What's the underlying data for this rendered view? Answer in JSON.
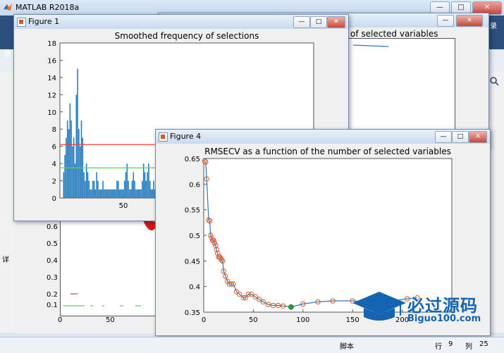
{
  "matlab": {
    "title": "MATLAB R2018a",
    "controls": {
      "minimize": "—",
      "maximize": "□",
      "close": "✕"
    },
    "toolstrip_fragments": {
      "left_char": "数",
      "left_char2": "当",
      "right_char": "录",
      "side_char": "详"
    },
    "status": {
      "script": "脚本",
      "row_label": "行",
      "row_value": "9",
      "col_label": "列",
      "col_value": "25"
    }
  },
  "figure1": {
    "title": "Figure 1",
    "controls": {
      "minimize": "—",
      "maximize": "□",
      "close": "✕"
    },
    "chart_data": {
      "type": "bar",
      "title": "Smoothed frequency of selections",
      "xlim": [
        0,
        200
      ],
      "ylim": [
        0,
        18
      ],
      "x_ticks": [
        "50"
      ],
      "y_ticks": [
        "0",
        "2",
        "4",
        "6",
        "8",
        "10",
        "12",
        "14",
        "16",
        "18"
      ],
      "threshold_red": 6.2,
      "threshold_green": 3.5,
      "bar_color": "#2c7fc1",
      "red_line_color": "#ff3b3b",
      "green_line_color": "#45e045",
      "values": [
        0,
        0,
        3,
        5,
        7,
        9,
        8,
        11,
        9,
        6,
        7,
        4,
        12,
        15,
        8,
        6,
        9,
        7,
        3,
        2,
        4,
        3,
        2,
        1,
        1,
        2,
        2,
        1,
        3,
        2,
        1,
        1,
        1,
        2,
        1,
        1,
        1,
        1,
        1,
        1,
        1,
        1,
        1,
        1,
        2,
        2,
        1,
        1,
        1,
        1,
        2,
        3,
        4,
        2,
        1,
        1,
        2,
        3,
        2,
        1,
        1,
        1,
        1,
        1,
        2,
        4,
        3,
        2,
        3,
        4,
        2,
        1,
        1,
        2,
        1,
        1,
        1,
        1,
        1,
        1,
        1,
        1,
        1,
        1,
        1,
        2,
        2,
        1,
        1,
        1,
        1,
        1,
        1,
        2,
        1,
        1,
        1,
        1,
        1,
        1,
        1,
        1,
        1,
        1,
        1,
        1,
        1,
        1,
        1,
        1,
        1,
        1,
        1,
        1,
        1,
        1,
        1,
        1,
        1,
        1,
        1,
        1,
        1,
        1,
        1,
        1,
        1,
        1,
        1,
        1,
        1,
        1,
        1,
        1,
        1,
        1,
        1,
        1,
        1,
        1,
        1,
        1,
        1,
        1,
        1,
        1,
        1,
        1,
        1,
        1,
        1,
        1,
        1,
        1,
        1,
        1,
        1,
        1,
        1,
        1,
        1,
        1,
        1,
        1,
        1,
        1,
        1,
        1,
        1,
        1,
        1,
        1,
        1,
        1,
        1,
        1,
        1,
        1,
        1,
        1,
        1,
        1,
        1,
        1,
        1,
        1,
        1,
        1,
        1,
        1,
        1,
        1,
        1,
        1,
        1,
        1,
        1,
        1,
        1,
        1
      ]
    }
  },
  "figure_behind": {
    "visible_title_fragment": "of selected variables"
  },
  "background_axes": {
    "y_ticks": [
      "0.6",
      "0.5",
      "0.4",
      "0.3",
      "0.2",
      "0.1"
    ],
    "x_ticks": [
      "0",
      "50"
    ]
  },
  "figure4": {
    "title": "Figure 4",
    "controls": {
      "minimize": "—",
      "maximize": "□",
      "close": "✕"
    },
    "chart_data": {
      "type": "line",
      "title": "RMSECV as a function of the number of selected variables",
      "xlim": [
        0,
        250
      ],
      "ylim": [
        0.35,
        0.65
      ],
      "x_ticks": [
        "0",
        "50",
        "100",
        "150",
        "200"
      ],
      "y_ticks": [
        "0.35",
        "0.4",
        "0.45",
        "0.5",
        "0.55",
        "0.6",
        "0.65"
      ],
      "line_color": "#2878c0",
      "marker_color": "#e05a2a",
      "best_marker_color": "#2ca02c",
      "series": [
        {
          "x": [
            1,
            2,
            3,
            5,
            6,
            7,
            8,
            9,
            10,
            11,
            12,
            13,
            14,
            15,
            16,
            17,
            18,
            19,
            20,
            22,
            24,
            26,
            28,
            30,
            33,
            36,
            40,
            42,
            45,
            48,
            52,
            56,
            60,
            65,
            70,
            75,
            80,
            88,
            100,
            115,
            130,
            150,
            170,
            190,
            205,
            215
          ],
          "y": [
            0.645,
            0.643,
            0.61,
            0.53,
            0.528,
            0.5,
            0.495,
            0.49,
            0.49,
            0.485,
            0.48,
            0.472,
            0.465,
            0.458,
            0.458,
            0.455,
            0.452,
            0.45,
            0.43,
            0.42,
            0.41,
            0.405,
            0.405,
            0.405,
            0.39,
            0.385,
            0.378,
            0.378,
            0.385,
            0.385,
            0.38,
            0.375,
            0.37,
            0.365,
            0.363,
            0.363,
            0.362,
            0.36,
            0.366,
            0.37,
            0.372,
            0.372,
            0.37,
            0.372,
            0.376,
            0.378
          ]
        }
      ],
      "best_point": {
        "x": 88,
        "y": 0.36
      }
    }
  },
  "watermark": {
    "chinese": "必过源码",
    "url": "Biguo100.com"
  }
}
